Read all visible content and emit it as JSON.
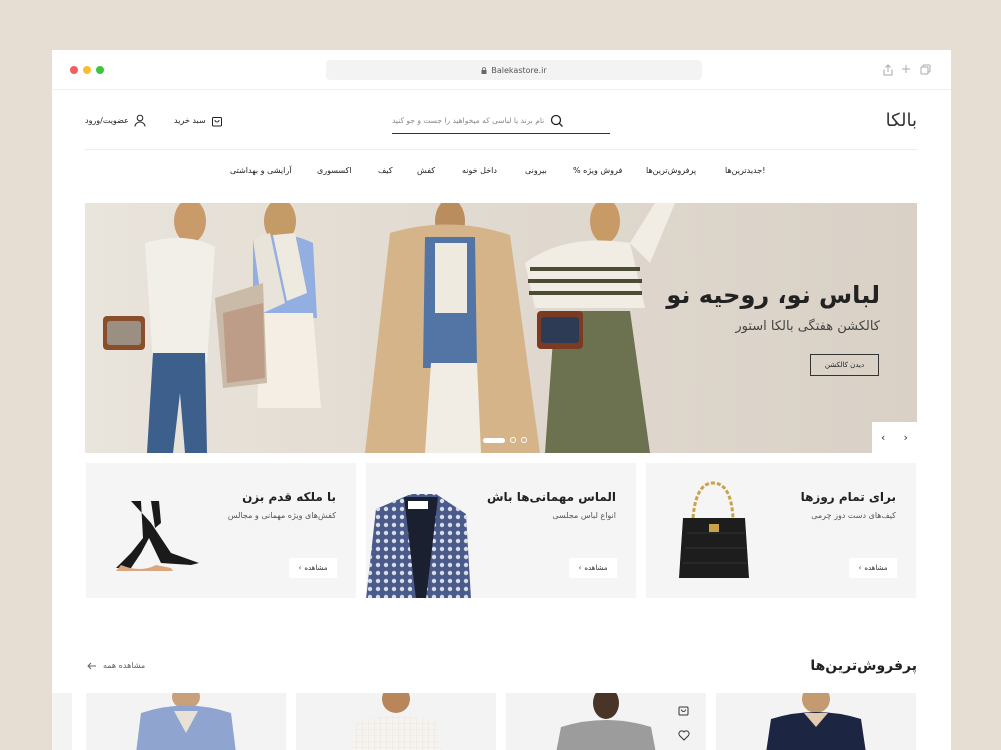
{
  "browser": {
    "url": "Balekastore.ir",
    "dots": [
      "#f25f58",
      "#f9be2e",
      "#3dc53f"
    ]
  },
  "header": {
    "logo": "بالکا",
    "search_placeholder": "نام برند یا لباسی که میخواهید را جست و جو کنید",
    "cart_label": "سبد خرید",
    "account_label": "عضویت/ورود"
  },
  "nav": [
    "جدیدترین‌ها!",
    "پرفروش‌ترین‌ها",
    "% فروش ویژه",
    "بیرونی",
    "داخل خونه",
    "کفش",
    "کیف",
    "اکسسوری",
    "آرایشی و بهداشتی"
  ],
  "hero": {
    "title": "لباس نو، روحیه نو",
    "subtitle": "کالکشن هفتگی بالکا استور",
    "button": "دیدن کالکشن"
  },
  "cards": [
    {
      "title": "برای تمام روزها",
      "subtitle": "کیف‌های دست دوز چرمی",
      "button": "مشاهده"
    },
    {
      "title": "الماس مهمانی‌ها باش",
      "subtitle": "انواع لباس مجلسی",
      "button": "مشاهده"
    },
    {
      "title": "با ملکه قدم بزن",
      "subtitle": "کفش‌های ویژه مهمانی و مجالس",
      "button": "مشاهده"
    }
  ],
  "bestsellers": {
    "title": "پرفروش‌ترین‌ها",
    "see_all": "مشاهده همه"
  },
  "colors": {
    "accent": "#222222",
    "page_bg": "#e6ded2",
    "hero_bg": "#e1dad0"
  }
}
